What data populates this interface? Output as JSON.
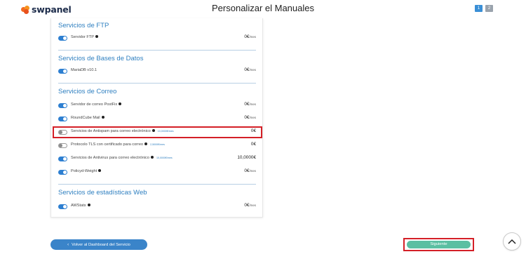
{
  "header": {
    "logo_text": "swpanel",
    "title": "Personalizar el Manuales",
    "lang_buttons": [
      "1",
      "2"
    ]
  },
  "sections": [
    {
      "title": "Servicios de FTP",
      "items": [
        {
          "label": "Servidor FTP",
          "price": "0€",
          "unit": "/mes",
          "enabled": true
        }
      ]
    },
    {
      "title": "Servicios de Bases de Datos",
      "items": [
        {
          "label": "MariaDB v10.1",
          "price": "0€",
          "unit": "/mes",
          "enabled": true
        }
      ]
    },
    {
      "title": "Servicios de Correo",
      "items": [
        {
          "label": "Servidor de correo PostFix",
          "price": "0€",
          "unit": "/mes",
          "enabled": true
        },
        {
          "label": "RoundCube Mail",
          "price": "0€",
          "unit": "/mes",
          "enabled": true
        },
        {
          "label": "Servicios de Antispam para correo electrónico",
          "sub": "10,0000€/mes",
          "price": "0€",
          "unit": "",
          "enabled": false
        },
        {
          "label": "Protocolo TLS con certificado para correo",
          "sub": "2,5000€/mes",
          "price": "0€",
          "unit": "",
          "enabled": false
        },
        {
          "label": "Servicios de Antivirus para correo electrónico",
          "sub": "10,0000€/mes",
          "price": "10,0000€",
          "unit": "",
          "enabled": true
        },
        {
          "label": "Policyd-Weight",
          "price": "0€",
          "unit": "/mes",
          "enabled": true
        }
      ]
    },
    {
      "title": "Servicios de estadísticas Web",
      "items": [
        {
          "label": "AWStats",
          "price": "0€",
          "unit": "/mes",
          "enabled": true
        }
      ]
    }
  ],
  "footer": {
    "back_label": "Volver al Dashboard del Servicio",
    "next_label": "Siguiente"
  },
  "colors": {
    "accent": "#2d7fd1",
    "section_title": "#2e7fc0",
    "next_button": "#5bbfa2",
    "highlight": "#d42027",
    "logo_orange": "#f26b21"
  },
  "icons": [
    "swpanel-logo-icon",
    "info-icon",
    "chevron-left-icon",
    "chevron-up-icon"
  ]
}
